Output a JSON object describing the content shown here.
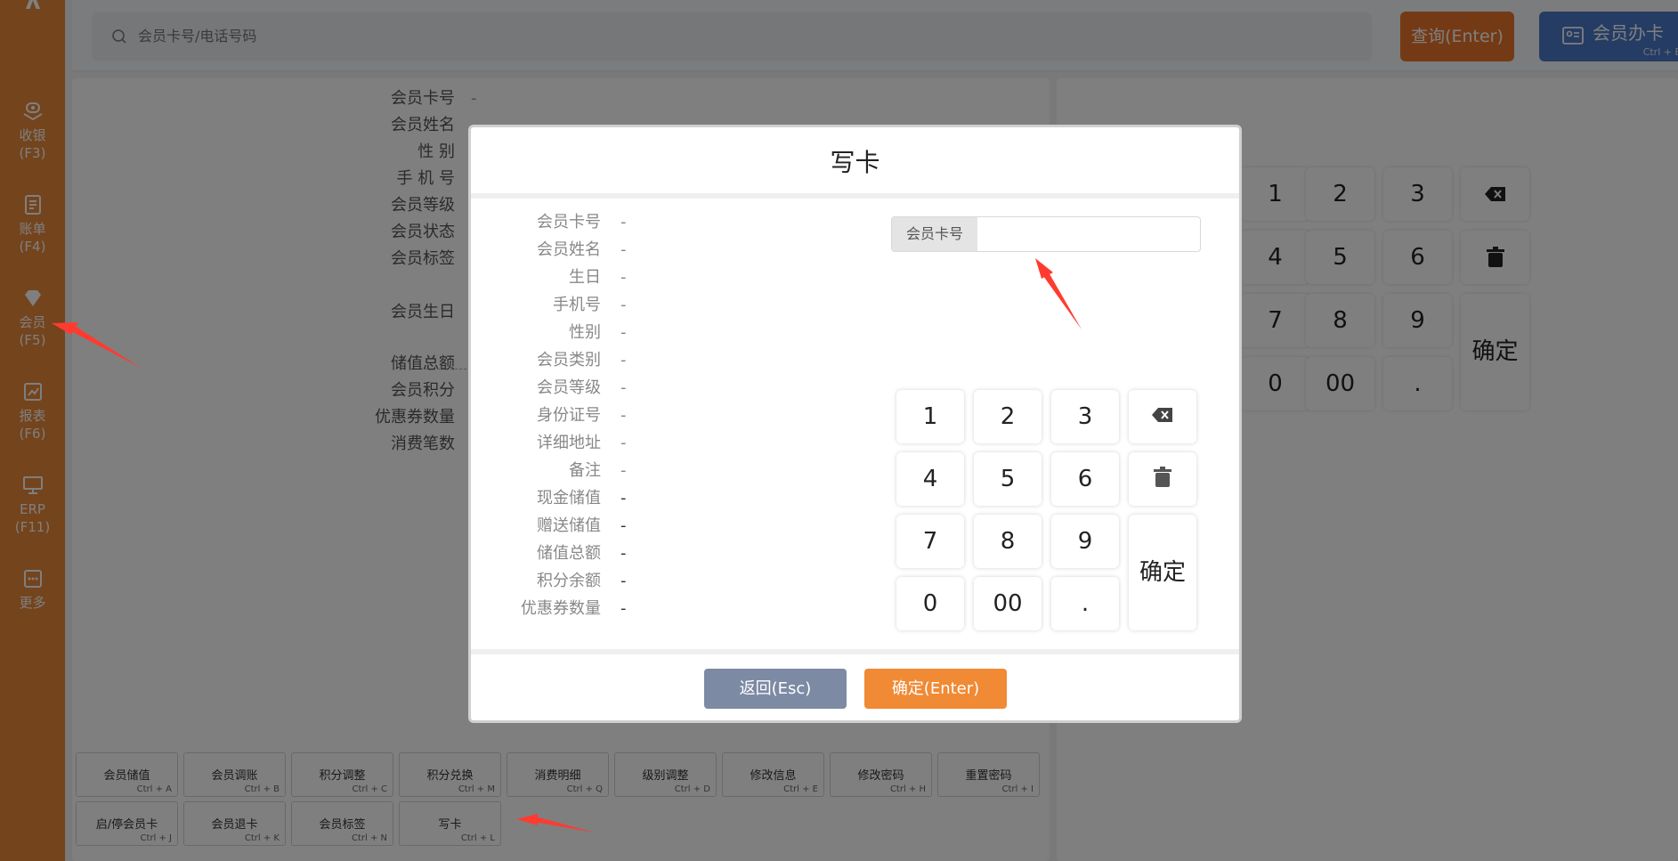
{
  "sidebar": {
    "items": [
      {
        "label": "收银",
        "key": "(F3)",
        "icon": "cashier-icon"
      },
      {
        "label": "账单",
        "key": "(F4)",
        "icon": "bill-icon"
      },
      {
        "label": "会员",
        "key": "(F5)",
        "icon": "member-icon"
      },
      {
        "label": "报表",
        "key": "(F6)",
        "icon": "report-icon"
      },
      {
        "label": "ERP",
        "key": "(F11)",
        "icon": "erp-icon"
      },
      {
        "label": "更多",
        "key": "",
        "icon": "more-icon"
      }
    ]
  },
  "search": {
    "placeholder": "会员卡号/电话号码"
  },
  "header": {
    "query_label": "查询(Enter)",
    "card_label": "会员办卡",
    "card_sub": "Ctrl + Enter"
  },
  "member_info": {
    "rows": [
      {
        "label": "会员卡号",
        "value": "-"
      },
      {
        "label": "会员姓名",
        "value": ""
      },
      {
        "label": "性 别",
        "value": ""
      },
      {
        "label": "手 机 号",
        "value": ""
      },
      {
        "label": "会员等级",
        "value": ""
      },
      {
        "label": "会员状态",
        "value": ""
      },
      {
        "label": "会员标签",
        "value": ""
      },
      {
        "label": "会员生日",
        "value": ""
      },
      {
        "label": "储值总额",
        "value": ""
      },
      {
        "label": "会员积分",
        "value": ""
      },
      {
        "label": "优惠券数量",
        "value": ""
      },
      {
        "label": "消费笔数",
        "value": ""
      }
    ]
  },
  "operations": [
    {
      "label": "会员储值",
      "key": "Ctrl + A"
    },
    {
      "label": "会员调账",
      "key": "Ctrl + B"
    },
    {
      "label": "积分调整",
      "key": "Ctrl + C"
    },
    {
      "label": "积分兑换",
      "key": "Ctrl + M"
    },
    {
      "label": "消费明细",
      "key": "Ctrl + Q"
    },
    {
      "label": "级别调整",
      "key": "Ctrl + D"
    },
    {
      "label": "修改信息",
      "key": "Ctrl + E"
    },
    {
      "label": "修改密码",
      "key": "Ctrl + H"
    },
    {
      "label": "重置密码",
      "key": "Ctrl + I"
    },
    {
      "label": "启/停会员卡",
      "key": "Ctrl + J"
    },
    {
      "label": "会员退卡",
      "key": "Ctrl + K"
    },
    {
      "label": "会员标签",
      "key": "Ctrl + N"
    },
    {
      "label": "写卡",
      "key": "Ctrl + L"
    }
  ],
  "bg_keypad": {
    "keys": [
      "1",
      "2",
      "3",
      "4",
      "5",
      "6",
      "7",
      "8",
      "9",
      "0",
      "00",
      "."
    ],
    "confirm": "确定"
  },
  "modal": {
    "title": "写卡",
    "rows": [
      {
        "label": "会员卡号",
        "value": "-"
      },
      {
        "label": "会员姓名",
        "value": "-"
      },
      {
        "label": "生日",
        "value": "-"
      },
      {
        "label": "手机号",
        "value": "-"
      },
      {
        "label": "性别",
        "value": "-"
      },
      {
        "label": "会员类别",
        "value": "-"
      },
      {
        "label": "会员等级",
        "value": "-"
      },
      {
        "label": "身份证号",
        "value": "-"
      },
      {
        "label": "详细地址",
        "value": "-"
      },
      {
        "label": "备注",
        "value": "-"
      },
      {
        "label": "现金储值",
        "value": "-"
      },
      {
        "label": "赠送储值",
        "value": "-"
      },
      {
        "label": "储值总额",
        "value": "-"
      },
      {
        "label": "积分余额",
        "value": "-"
      },
      {
        "label": "优惠券数量",
        "value": "-"
      }
    ],
    "card_field": {
      "label": "会员卡号",
      "value": ""
    },
    "keys": [
      "1",
      "2",
      "3",
      "4",
      "5",
      "6",
      "7",
      "8",
      "9",
      "0",
      "00",
      "."
    ],
    "confirm_key": "确定",
    "back_label": "返回(Esc)",
    "ok_label": "确定(Enter)"
  },
  "colors": {
    "sidebar": "#e8883a",
    "query_button": "#e8742a",
    "card_button": "#4a78c8",
    "back_button": "#7d8aa3",
    "ok_button": "#f08a34",
    "annotation": "#ff3b30"
  }
}
